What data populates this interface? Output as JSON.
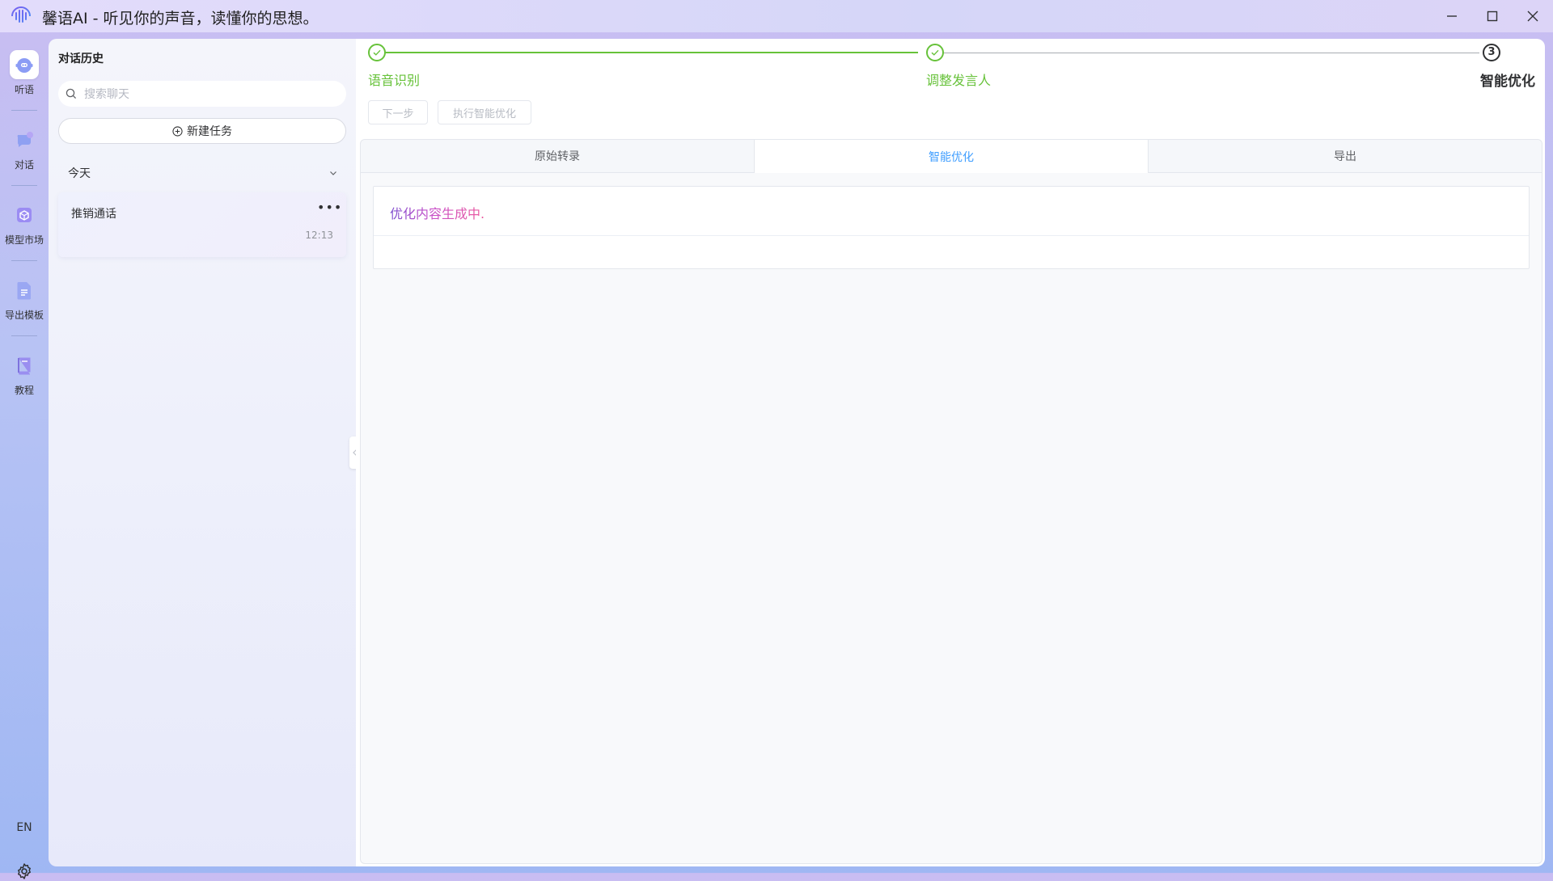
{
  "window": {
    "title": "馨语AI - 听见你的声音，读懂你的思想。"
  },
  "nav": {
    "items": [
      {
        "label": "听语",
        "icon": "robot-icon"
      },
      {
        "label": "对话",
        "icon": "chat-bubble-icon"
      },
      {
        "label": "模型市场",
        "icon": "cube-icon"
      },
      {
        "label": "导出模板",
        "icon": "document-icon"
      },
      {
        "label": "教程",
        "icon": "book-icon"
      }
    ],
    "language": "EN",
    "accent": "#7b8ff0"
  },
  "history": {
    "title": "对话历史",
    "search_placeholder": "搜索聊天",
    "new_task": "新建任务",
    "groups": [
      {
        "label": "今天",
        "items": [
          {
            "title": "推销通话",
            "time": "12:13"
          }
        ]
      }
    ]
  },
  "steps": [
    {
      "label": "语音识别",
      "status": "done"
    },
    {
      "label": "调整发言人",
      "status": "done"
    },
    {
      "label": "智能优化",
      "status": "current",
      "number": "3"
    }
  ],
  "actions": {
    "next": "下一步",
    "optimize": "执行智能优化"
  },
  "tabs": [
    {
      "label": "原始转录",
      "active": false
    },
    {
      "label": "智能优化",
      "active": true
    },
    {
      "label": "导出",
      "active": false
    }
  ],
  "content": {
    "status": "优化内容生成中."
  },
  "colors": {
    "success": "#67c23a",
    "primary": "#409eff",
    "status_gradient_start": "#7c4dce",
    "status_gradient_end": "#ec5a9d"
  }
}
